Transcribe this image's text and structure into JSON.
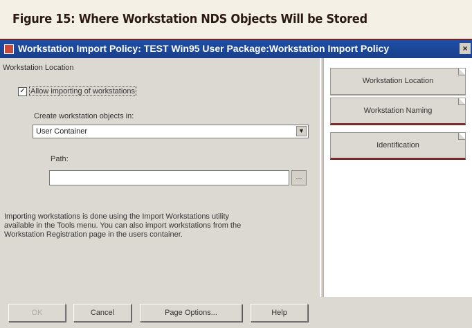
{
  "figure": {
    "caption": "Figure 15: Where Workstation NDS Objects Will be Stored"
  },
  "window": {
    "title": "Workstation Import Policy: TEST Win95 User Package:Workstation Import Policy",
    "close_glyph": "×"
  },
  "panel": {
    "title": "Workstation Location",
    "allow_import": {
      "label": "Allow importing of workstations",
      "checked": true,
      "check_glyph": "✓"
    },
    "create_in": {
      "label": "Create workstation objects in:",
      "value": "User Container",
      "dropdown_glyph": "▼"
    },
    "path": {
      "label": "Path:",
      "value": "",
      "browse_label": "..."
    },
    "info_text": "Importing workstations is done using the Import Workstations utility available in the Tools menu. You can also import workstations from the Workstation Registration page in the users container."
  },
  "tabs": [
    {
      "label": "Workstation Location",
      "active": true
    },
    {
      "label": "Workstation Naming",
      "active": false
    },
    {
      "label": "Identification",
      "active": false
    }
  ],
  "buttons": {
    "ok": "OK",
    "cancel": "Cancel",
    "page_options": "Page Options...",
    "help": "Help"
  }
}
